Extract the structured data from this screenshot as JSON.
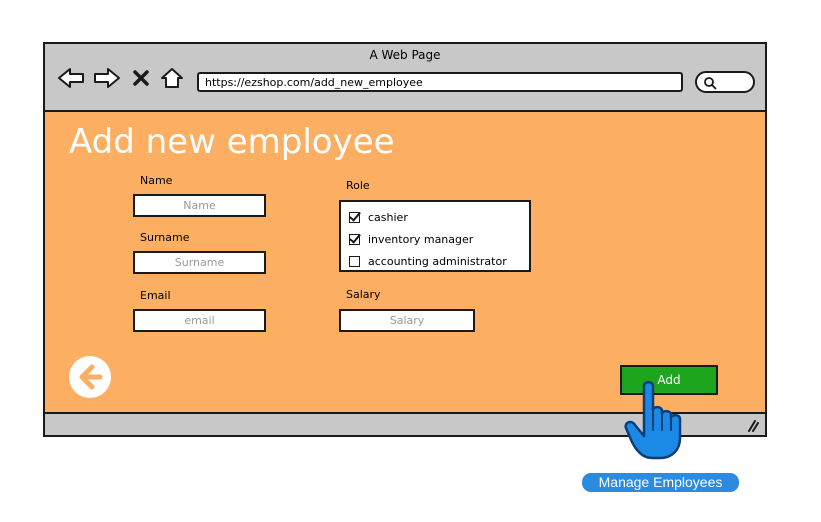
{
  "window": {
    "title": "A Web Page",
    "url": "https://ezshop.com/add_new_employee"
  },
  "icons": {
    "back": "back-arrow-icon",
    "forward": "forward-arrow-icon",
    "stop": "close-icon",
    "home": "home-icon",
    "search": "search-icon",
    "page_back": "back-circle-icon",
    "cursor": "hand-pointer-icon",
    "resize": "resize-grip-icon"
  },
  "page": {
    "title": "Add new employee"
  },
  "form": {
    "name": {
      "label": "Name",
      "placeholder": "Name"
    },
    "surname": {
      "label": "Surname",
      "placeholder": "Surname"
    },
    "email": {
      "label": "Email",
      "placeholder": "email"
    },
    "role": {
      "label": "Role",
      "options": [
        {
          "label": "cashier",
          "checked": true
        },
        {
          "label": "inventory manager",
          "checked": true
        },
        {
          "label": "accounting administrator",
          "checked": false
        }
      ]
    },
    "salary": {
      "label": "Salary",
      "placeholder": "Salary"
    }
  },
  "actions": {
    "add_label": "Add"
  },
  "link": {
    "label": "Manage Employees"
  },
  "colors": {
    "content_bg": "#fcae62",
    "add_button": "#1ea51e",
    "link_badge": "#2a8be0",
    "chrome": "#c8c8c8"
  }
}
